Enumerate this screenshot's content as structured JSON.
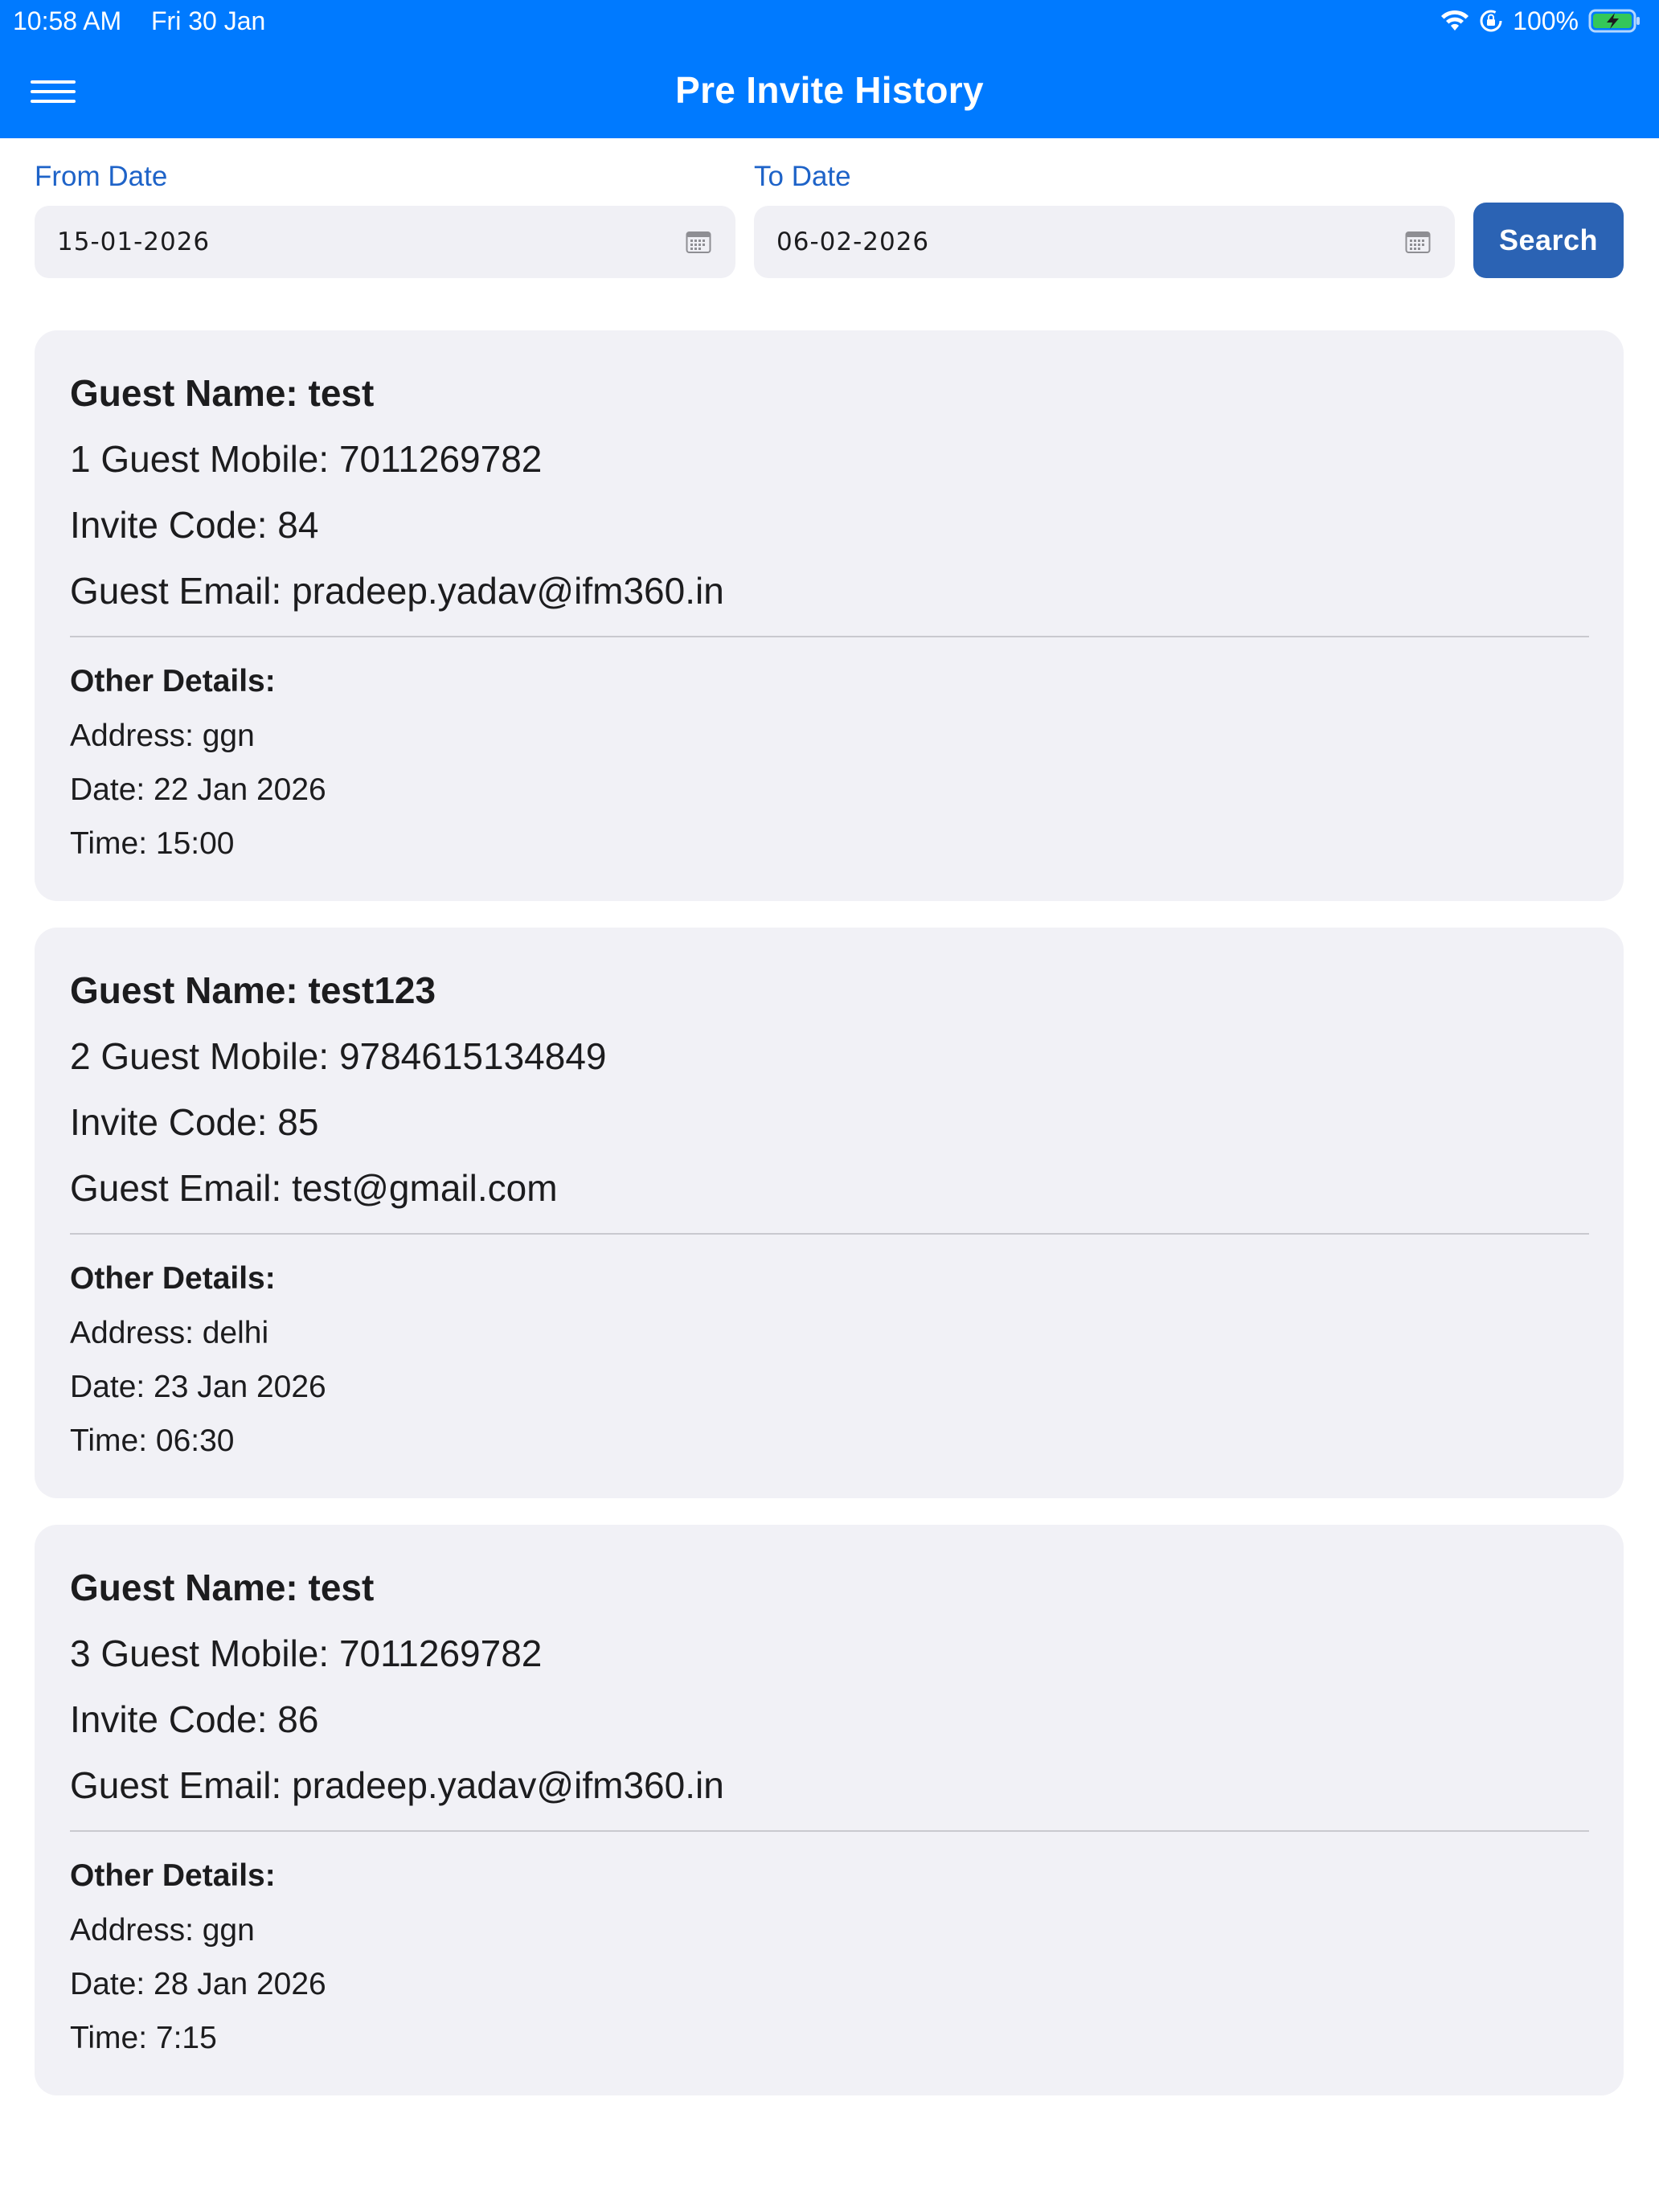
{
  "status_bar": {
    "time": "10:58 AM",
    "date": "Fri 30 Jan",
    "battery_percent": "100%",
    "battery_level": 1.0,
    "battery_color": "#34c759",
    "icons": [
      "wifi-icon",
      "lock-rotation-icon",
      "battery-charging-icon"
    ]
  },
  "nav": {
    "title": "Pre Invite History",
    "menu_icon": "hamburger-menu-icon",
    "background_color": "#007aff"
  },
  "filters": {
    "from_label": "From Date",
    "from_value": "15-01-2026",
    "to_label": "To Date",
    "to_value": "06-02-2026",
    "calendar_icon": "calendar-icon",
    "search_label": "Search",
    "search_color": "#2b63b4"
  },
  "invites": [
    {
      "guest_name": "Guest Name: test",
      "guest_mobile": "1 Guest Mobile: 7011269782",
      "invite_code": "Invite Code: 84",
      "guest_email": "Guest Email: pradeep.yadav@ifm360.in",
      "other_details_heading": "Other Details:",
      "address": "Address: ggn",
      "date": "Date: 22 Jan 2026",
      "time": "Time: 15:00"
    },
    {
      "guest_name": "Guest Name: test123",
      "guest_mobile": "2 Guest Mobile: 9784615134849",
      "invite_code": "Invite Code: 85",
      "guest_email": "Guest Email: test@gmail.com",
      "other_details_heading": "Other Details:",
      "address": "Address: delhi",
      "date": "Date: 23 Jan 2026",
      "time": "Time: 06:30"
    },
    {
      "guest_name": "Guest Name: test",
      "guest_mobile": "3 Guest Mobile: 7011269782",
      "invite_code": "Invite Code: 86",
      "guest_email": "Guest Email: pradeep.yadav@ifm360.in",
      "other_details_heading": "Other Details:",
      "address": "Address: ggn",
      "date": "Date: 28 Jan 2026",
      "time": "Time: 7:15"
    }
  ]
}
